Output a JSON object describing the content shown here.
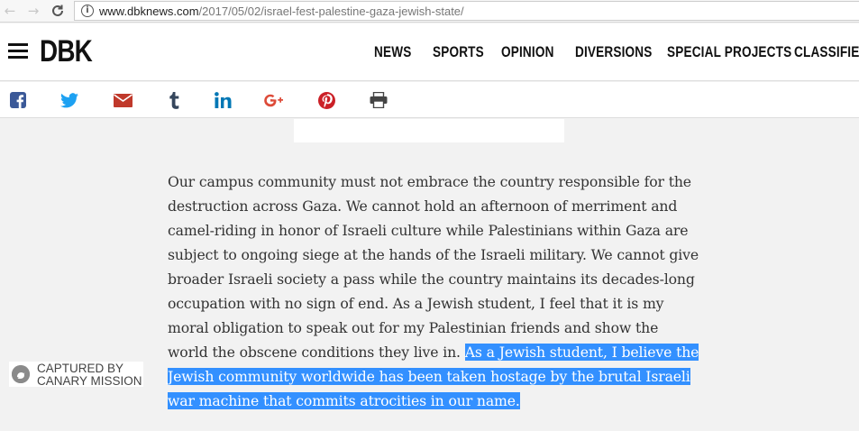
{
  "browser": {
    "back_glyph": "←",
    "forward_glyph": "→",
    "reload_glyph": "C",
    "info_glyph": "i",
    "url_host": "www.dbknews.com",
    "url_path": "/2017/05/02/israel-fest-palestine-gaza-jewish-state/"
  },
  "header": {
    "logo": "DBK",
    "nav": [
      "NEWS",
      "SPORTS",
      "OPINION",
      "DIVERSIONS",
      "SPECIAL PROJECTS",
      "CLASSIFIEDS"
    ]
  },
  "share_bar": {
    "icons": [
      "facebook-icon",
      "twitter-icon",
      "email-icon",
      "tumblr-icon",
      "linkedin-icon",
      "google-plus-icon",
      "pinterest-icon",
      "print-icon"
    ],
    "colors": {
      "facebook": "#3b5998",
      "twitter": "#1da1f2",
      "email": "#c0392b",
      "tumblr": "#35465c",
      "linkedin": "#0077b5",
      "google_plus": "#dd4b39",
      "pinterest": "#cb2027",
      "print": "#444444"
    }
  },
  "article": {
    "plain_text": "Our campus community must not embrace the country responsible for the destruction across Gaza. We cannot hold an afternoon of merriment and camel-riding in honor of Israeli culture while Palestinians within Gaza are subject to ongoing siege at the hands of the Israeli military. We cannot give broader Israeli society a pass while the country maintains its decades-long occupation with no sign of end. As a Jewish student, I feel that it is my moral obligation to speak out for my Palestinian friends and show the world the obscene conditions they live in. ",
    "highlighted_text": "As a Jewish student, I believe the Jewish community worldwide has been taken hostage by the brutal Israeli war machine that commits atrocities in our name.",
    "highlight_color": "#3390ff"
  },
  "watermark": {
    "line1": "CAPTURED BY",
    "line2": "CANARY MISSION"
  }
}
